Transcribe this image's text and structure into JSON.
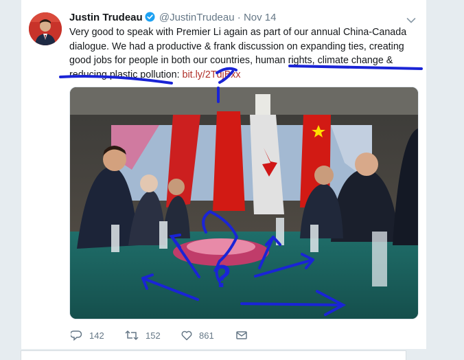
{
  "tweet": {
    "author_name": "Justin Trudeau",
    "handle": "@JustinTrudeau",
    "separator": "·",
    "date": "Nov 14",
    "text_main": "Very good to speak with Premier Li again as part of our annual China-Canada dialogue. We had a productive & frank discussion on expanding ties, creating good jobs for people in both our countries, human rights, climate change & reducing plastic pollution: ",
    "link": "bit.ly/2TdjBxx"
  },
  "actions": {
    "replies": "142",
    "retweets": "152",
    "likes": "861"
  },
  "icons": {
    "verified": "verified-badge-icon",
    "more": "chevron-down-icon",
    "reply": "reply-icon",
    "retweet": "retweet-icon",
    "like": "heart-icon",
    "dm": "envelope-icon"
  },
  "colors": {
    "link": "#b0302a",
    "annotation_ink": "#1a24d6",
    "verified": "#1da1f2",
    "muted": "#657786"
  },
  "annotation_text": "?"
}
